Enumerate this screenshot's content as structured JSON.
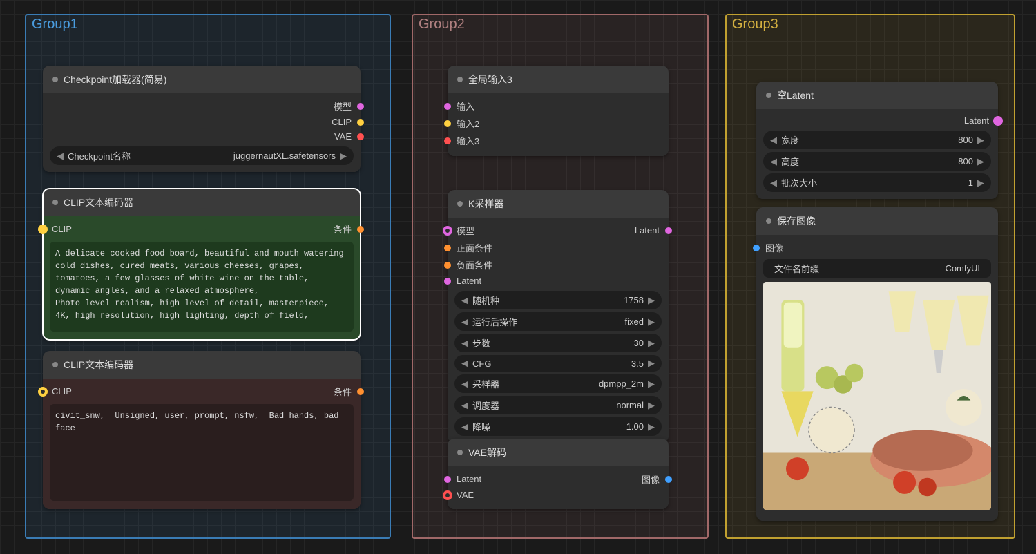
{
  "groups": {
    "g1": "Group1",
    "g2": "Group2",
    "g3": "Group3"
  },
  "checkpoint": {
    "title": "Checkpoint加载器(简易)",
    "out_model": "模型",
    "out_clip": "CLIP",
    "out_vae": "VAE",
    "field_label": "Checkpoint名称",
    "field_value": "juggernautXL.safetensors"
  },
  "clip_pos": {
    "title": "CLIP文本编码器",
    "in_clip": "CLIP",
    "out_cond": "条件",
    "text": "A delicate cooked food board, beautiful and mouth watering cold dishes, cured meats, various cheeses, grapes, tomatoes, a few glasses of white wine on the table, dynamic angles, and a relaxed atmosphere,\nPhoto level realism, high level of detail, masterpiece, 4K, high resolution, high lighting, depth of field,"
  },
  "clip_neg": {
    "title": "CLIP文本编码器",
    "in_clip": "CLIP",
    "out_cond": "条件",
    "text": "civit_snw,  Unsigned, user, prompt, nsfw,  Bad hands, bad face"
  },
  "global_in": {
    "title": "全局输入3",
    "in1": "输入",
    "in2": "输入2",
    "in3": "输入3"
  },
  "ksampler": {
    "title": "K采样器",
    "in_model": "模型",
    "in_pos": "正面条件",
    "in_neg": "负面条件",
    "in_latent": "Latent",
    "out_latent": "Latent",
    "seed_lbl": "随机种",
    "seed_val": "1758",
    "after_lbl": "运行后操作",
    "after_val": "fixed",
    "steps_lbl": "步数",
    "steps_val": "30",
    "cfg_lbl": "CFG",
    "cfg_val": "3.5",
    "sampler_lbl": "采样器",
    "sampler_val": "dpmpp_2m",
    "sched_lbl": "调度器",
    "sched_val": "normal",
    "denoise_lbl": "降噪",
    "denoise_val": "1.00"
  },
  "vae_decode": {
    "title": "VAE解码",
    "in_latent": "Latent",
    "in_vae": "VAE",
    "out_img": "图像"
  },
  "empty_latent": {
    "title": "空Latent",
    "out_latent": "Latent",
    "w_lbl": "宽度",
    "w_val": "800",
    "h_lbl": "高度",
    "h_val": "800",
    "b_lbl": "批次大小",
    "b_val": "1"
  },
  "save_img": {
    "title": "保存图像",
    "in_img": "图像",
    "prefix_lbl": "文件名前缀",
    "prefix_val": "ComfyUI"
  }
}
